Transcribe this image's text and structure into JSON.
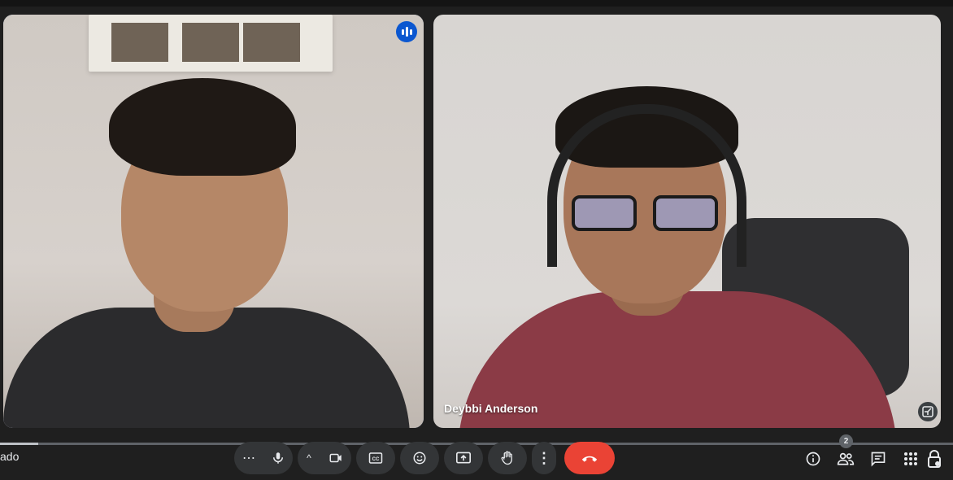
{
  "meeting": {
    "name_fragment": "ado"
  },
  "participants": [
    {
      "name": "",
      "speaking": true,
      "self_view": true
    },
    {
      "name": "Deybbi Anderson",
      "speaking": false
    }
  ],
  "toolbar": {
    "more_options_label": "⋯",
    "caret_label": "^",
    "menu_dots": "⋮"
  },
  "right_panel": {
    "people_count": "2"
  },
  "playback": {
    "progress_fraction": 0.04
  },
  "colors": {
    "accent": "#a8c7fa",
    "end_call": "#ea4335",
    "active_speaker": "#0b57d0",
    "toolbar_button": "#333537"
  },
  "icons": [
    "more-horiz-icon",
    "mic-icon",
    "chevron-up-icon",
    "videocam-icon",
    "captions-icon",
    "emoji-icon",
    "present-icon",
    "raise-hand-icon",
    "more-vert-icon",
    "call-end-icon",
    "info-icon",
    "people-icon",
    "chat-icon",
    "apps-icon",
    "host-controls-icon",
    "audio-level-icon",
    "minimize-icon"
  ]
}
